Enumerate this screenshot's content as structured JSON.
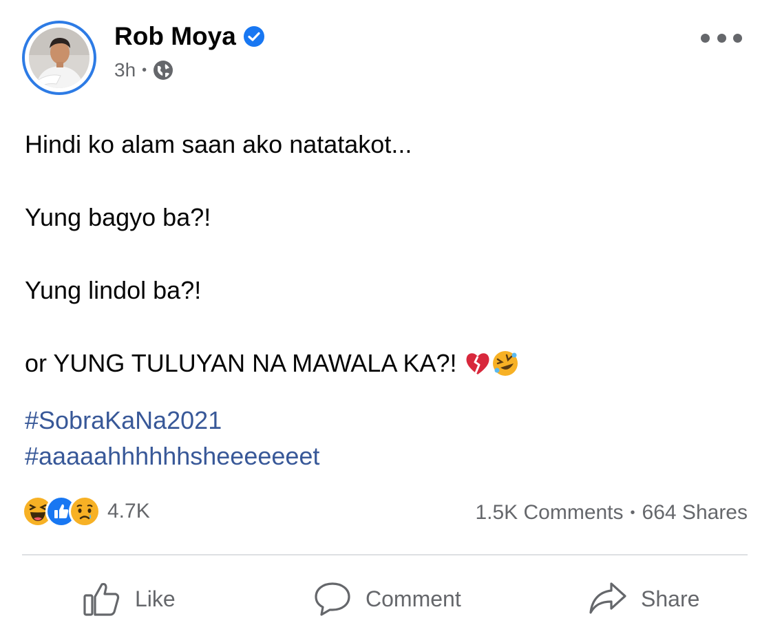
{
  "post": {
    "author": {
      "name": "Rob Moya",
      "verified": true
    },
    "timestamp": "3h",
    "audience_icon": "globe-icon",
    "more_icon": "more-options-icon",
    "lines": [
      {
        "text": "Hindi ko alam saan ako natatakot..."
      },
      {
        "text": "Yung bagyo ba?!"
      },
      {
        "text": "Yung lindol ba?!"
      },
      {
        "text": "or YUNG TULUYAN NA MAWALA KA?!",
        "emojis": [
          "broken-heart-emoji",
          "rolling-laughing-emoji"
        ]
      }
    ],
    "hashtags": [
      "#SobraKaNa2021",
      "#aaaaahhhhhhsheeeeeeet"
    ]
  },
  "stats": {
    "reactions": [
      "haha-reaction-icon",
      "like-reaction-icon",
      "sad-reaction-icon"
    ],
    "reaction_count": "4.7K",
    "comments": "1.5K Comments",
    "separator": "•",
    "shares": "664 Shares"
  },
  "actions": {
    "like": "Like",
    "comment": "Comment",
    "share": "Share"
  },
  "colors": {
    "accent": "#2d7be5",
    "hashtag": "#385898",
    "secondary_text": "#65676b",
    "like_blue": "#1877f2",
    "reaction_yellow": "#f7b125"
  }
}
